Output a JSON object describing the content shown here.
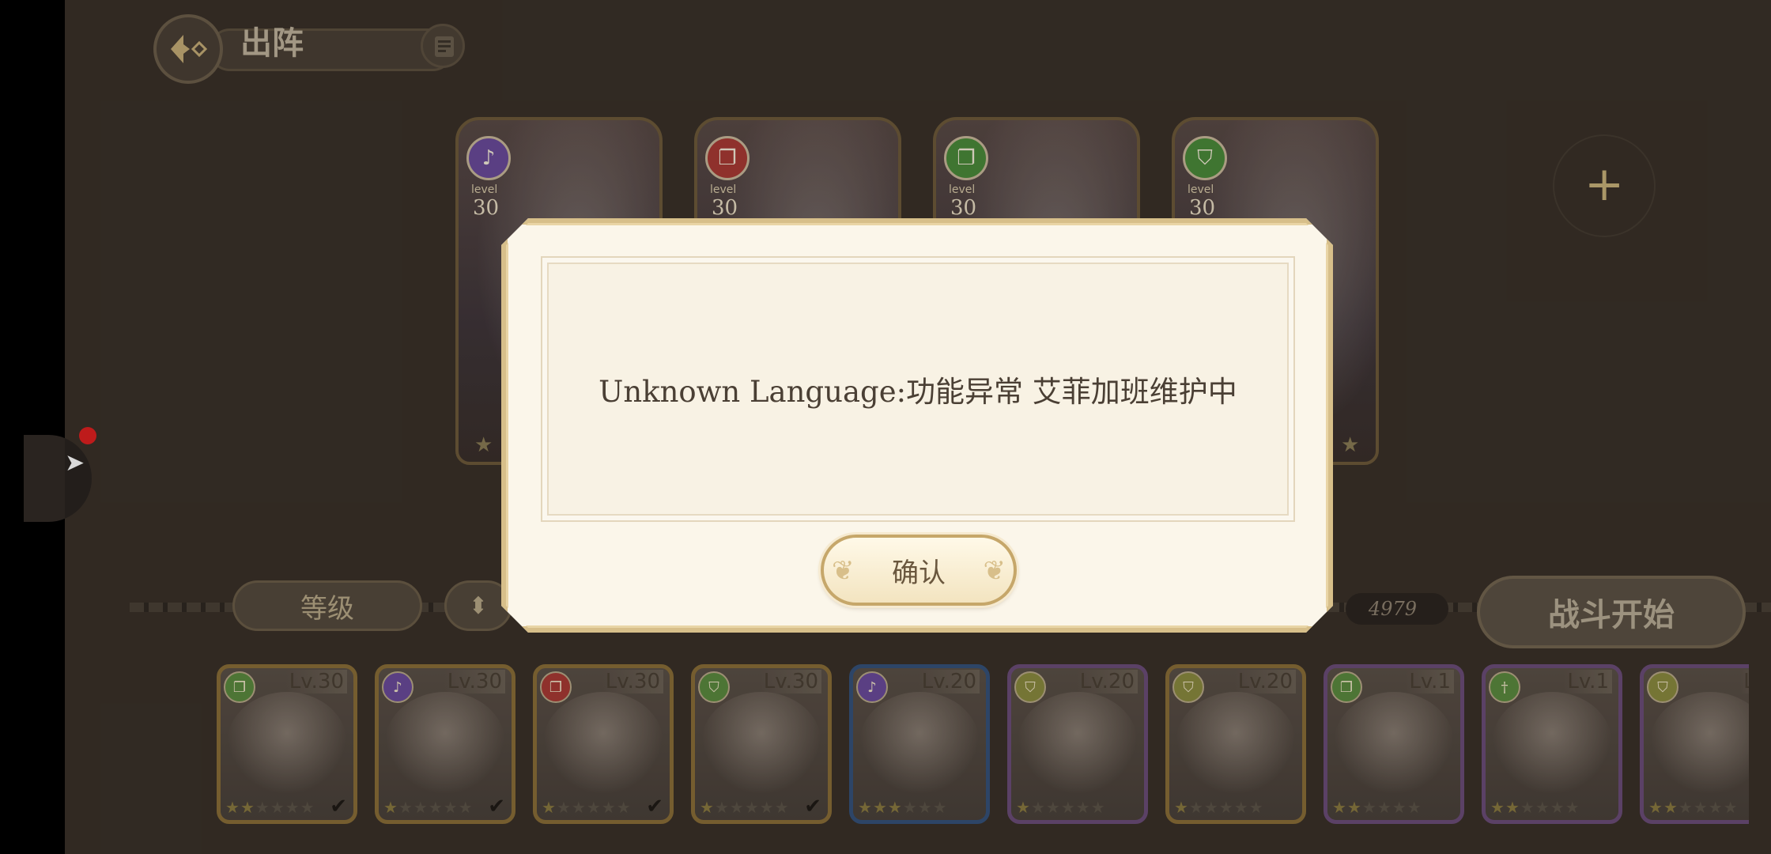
{
  "header": {
    "title": "出阵"
  },
  "team": [
    {
      "level_small": "level",
      "level": "30",
      "class_icon": "harp-icon",
      "icon_color": "#6a4b9a"
    },
    {
      "level_small": "level",
      "level": "30",
      "class_icon": "book-icon",
      "icon_color": "#a83a34"
    },
    {
      "level_small": "level",
      "level": "30",
      "class_icon": "book-icon",
      "icon_color": "#4b8a3a"
    },
    {
      "level_small": "level",
      "level": "30",
      "class_icon": "shield-icon",
      "icon_color": "#4b8a3a"
    }
  ],
  "sort": {
    "label": "等级"
  },
  "power": {
    "value": "4979"
  },
  "start_button": {
    "label": "战斗开始"
  },
  "roster": [
    {
      "level": "Lv.30",
      "icon": "book-icon",
      "icon_color": "#5b8a3f",
      "stars": 2,
      "selected": true,
      "rarity": "gold"
    },
    {
      "level": "Lv.30",
      "icon": "harp-icon",
      "icon_color": "#6a4b9a",
      "stars": 1,
      "selected": true,
      "rarity": "gold"
    },
    {
      "level": "Lv.30",
      "icon": "book-icon",
      "icon_color": "#a83a34",
      "stars": 1,
      "selected": true,
      "rarity": "gold"
    },
    {
      "level": "Lv.30",
      "icon": "shield-icon",
      "icon_color": "#5b8a3f",
      "stars": 1,
      "selected": true,
      "rarity": "gold"
    },
    {
      "level": "Lv.20",
      "icon": "harp-icon",
      "icon_color": "#6a4b9a",
      "stars": 3,
      "selected": false,
      "rarity": "blue"
    },
    {
      "level": "Lv.20",
      "icon": "shield-icon",
      "icon_color": "#8a8a3f",
      "stars": 1,
      "selected": false,
      "rarity": "purple"
    },
    {
      "level": "Lv.20",
      "icon": "shield-icon",
      "icon_color": "#8a8a3f",
      "stars": 1,
      "selected": false,
      "rarity": "gold"
    },
    {
      "level": "Lv.1",
      "icon": "book-icon",
      "icon_color": "#5b8a3f",
      "stars": 2,
      "selected": false,
      "rarity": "purple"
    },
    {
      "level": "Lv.1",
      "icon": "sword-icon",
      "icon_color": "#5b8a3f",
      "stars": 2,
      "selected": false,
      "rarity": "purple"
    },
    {
      "level": "Lv",
      "icon": "shield-icon",
      "icon_color": "#8a8a3f",
      "stars": 2,
      "selected": false,
      "rarity": "purple"
    }
  ],
  "dialog": {
    "message": "Unknown Language:功能异常 艾菲加班维护中",
    "confirm_label": "确认"
  }
}
